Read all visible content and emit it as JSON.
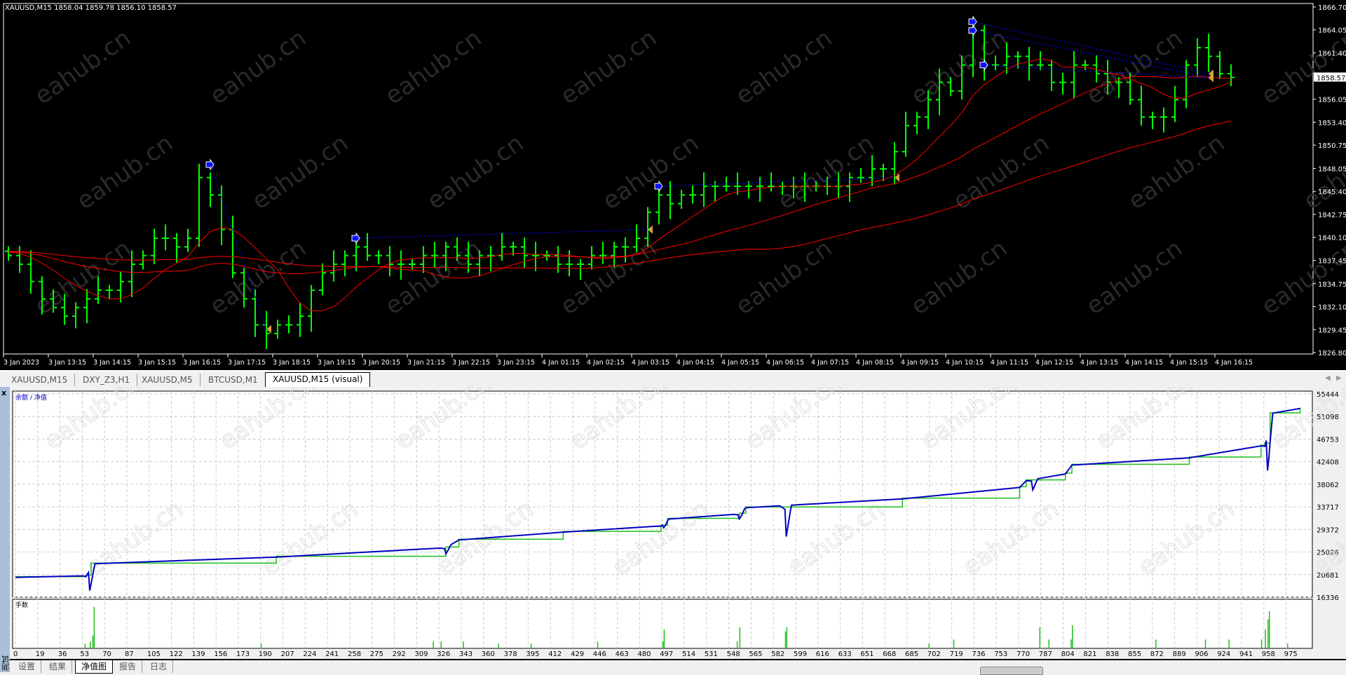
{
  "chart": {
    "symbol_header": "XAUUSD,M15  1858.04 1859.78 1856.10 1858.57",
    "current_price": "1858.57",
    "price_labels": [
      "1866.70",
      "1864.05",
      "1861.40",
      "1856.05",
      "1853.40",
      "1850.75",
      "1848.05",
      "1845.40",
      "1842.75",
      "1840.10",
      "1837.45",
      "1834.75",
      "1832.10",
      "1829.45",
      "1826.80"
    ],
    "time_labels": [
      "3 Jan 2023",
      "3 Jan 13:15",
      "3 Jan 14:15",
      "3 Jan 15:15",
      "3 Jan 16:15",
      "3 Jan 17:15",
      "3 Jan 18:15",
      "3 Jan 19:15",
      "3 Jan 20:15",
      "3 Jan 21:15",
      "3 Jan 22:15",
      "3 Jan 23:15",
      "4 Jan 01:15",
      "4 Jan 02:15",
      "4 Jan 03:15",
      "4 Jan 04:15",
      "4 Jan 05:15",
      "4 Jan 06:15",
      "4 Jan 07:15",
      "4 Jan 08:15",
      "4 Jan 09:15",
      "4 Jan 10:15",
      "4 Jan 11:15",
      "4 Jan 12:15",
      "4 Jan 13:15",
      "4 Jan 14:15",
      "4 Jan 15:15",
      "4 Jan 16:15"
    ],
    "colors": {
      "bars": "#00ff00",
      "ma": "#ff0000",
      "trades": "#0000ff",
      "background": "#000000"
    }
  },
  "chart_data": [
    {
      "type": "ohlc",
      "title": "XAUUSD,M15",
      "ylim": [
        1826.8,
        1866.7
      ],
      "close": [
        1838,
        1837,
        1835,
        1833,
        1832,
        1831,
        1832,
        1833,
        1834,
        1834,
        1835,
        1837,
        1838,
        1840,
        1840,
        1839,
        1840,
        1847,
        1845,
        1841,
        1836,
        1833,
        1830,
        1829,
        1830,
        1830,
        1831,
        1834,
        1836,
        1837,
        1838,
        1839,
        1838,
        1838,
        1837,
        1837,
        1837,
        1838,
        1838,
        1839,
        1838,
        1837,
        1838,
        1838,
        1839,
        1839,
        1838,
        1838,
        1838,
        1837,
        1837,
        1837,
        1838,
        1838,
        1839,
        1839,
        1840,
        1843,
        1845,
        1844,
        1845,
        1845,
        1846,
        1846,
        1846,
        1846,
        1846,
        1846,
        1846,
        1846,
        1846,
        1846,
        1846,
        1846,
        1846,
        1847,
        1847,
        1848,
        1848,
        1850,
        1853,
        1854,
        1856,
        1858,
        1857,
        1860,
        1864,
        1860,
        1860,
        1861,
        1861,
        1860,
        1860,
        1858,
        1858,
        1860,
        1860,
        1859,
        1858,
        1858,
        1856,
        1854,
        1854,
        1854,
        1856,
        1860,
        1862,
        1861,
        1859,
        1858.57
      ],
      "ma_periods": [
        8,
        21,
        50
      ]
    },
    {
      "type": "line",
      "title": "余额 / 净值",
      "ylim": [
        16336,
        55444
      ],
      "y_labels": [
        "55444",
        "51098",
        "46753",
        "42408",
        "38062",
        "33717",
        "29372",
        "25026",
        "20681",
        "16336"
      ],
      "x_labels": [
        "0",
        "19",
        "36",
        "53",
        "70",
        "87",
        "105",
        "122",
        "139",
        "156",
        "173",
        "190",
        "207",
        "224",
        "241",
        "258",
        "275",
        "292",
        "309",
        "326",
        "343",
        "360",
        "378",
        "395",
        "412",
        "429",
        "446",
        "463",
        "480",
        "497",
        "514",
        "531",
        "548",
        "565",
        "582",
        "599",
        "616",
        "633",
        "651",
        "668",
        "685",
        "702",
        "719",
        "736",
        "753",
        "770",
        "787",
        "804",
        "821",
        "838",
        "855",
        "872",
        "889",
        "906",
        "924",
        "941",
        "958",
        "975"
      ],
      "xlim": [
        0,
        985
      ],
      "balance": [
        [
          0,
          20300
        ],
        [
          54,
          20600
        ],
        [
          58,
          22900
        ],
        [
          200,
          24200
        ],
        [
          330,
          26000
        ],
        [
          340,
          27500
        ],
        [
          420,
          29000
        ],
        [
          495,
          30200
        ],
        [
          500,
          31500
        ],
        [
          555,
          32500
        ],
        [
          560,
          33700
        ],
        [
          680,
          35400
        ],
        [
          770,
          37600
        ],
        [
          775,
          38900
        ],
        [
          805,
          40200
        ],
        [
          810,
          41900
        ],
        [
          900,
          43300
        ],
        [
          955,
          45600
        ],
        [
          958,
          46000
        ],
        [
          962,
          51800
        ],
        [
          985,
          52800
        ]
      ],
      "equity_dips": [
        [
          57,
          17600
        ],
        [
          330,
          24700
        ],
        [
          497,
          29700
        ],
        [
          555,
          31400
        ],
        [
          591,
          28000
        ],
        [
          780,
          37000
        ],
        [
          960,
          40700
        ]
      ],
      "lots_label": "手数",
      "lots": [
        [
          53,
          0.1
        ],
        [
          57,
          0.15
        ],
        [
          59,
          0.3
        ],
        [
          60,
          1.0
        ],
        [
          188,
          0.1
        ],
        [
          320,
          0.15
        ],
        [
          326,
          0.15
        ],
        [
          343,
          0.15
        ],
        [
          370,
          0.1
        ],
        [
          395,
          0.1
        ],
        [
          446,
          0.15
        ],
        [
          496,
          0.15
        ],
        [
          497,
          0.45
        ],
        [
          553,
          0.15
        ],
        [
          555,
          0.5
        ],
        [
          590,
          0.4
        ],
        [
          591,
          0.5
        ],
        [
          700,
          0.1
        ],
        [
          719,
          0.2
        ],
        [
          785,
          0.5
        ],
        [
          792,
          0.2
        ],
        [
          809,
          0.2
        ],
        [
          810,
          0.55
        ],
        [
          874,
          0.2
        ],
        [
          912,
          0.2
        ],
        [
          930,
          0.2
        ],
        [
          955,
          0.2
        ],
        [
          958,
          0.45
        ],
        [
          960,
          0.7
        ],
        [
          961,
          0.9
        ],
        [
          975,
          0.1
        ]
      ]
    }
  ],
  "tabs": [
    "XAUUSD,M15",
    "DXY_Z3,H1",
    "XAUUSD,M5",
    "BTCUSD,M1",
    "XAUUSD,M15 (visual)"
  ],
  "tester": {
    "close_label": "x",
    "panel_label": "测试",
    "tabs": [
      "设置",
      "结果",
      "净值图",
      "报告",
      "日志"
    ]
  },
  "watermark": "eahub.cn"
}
